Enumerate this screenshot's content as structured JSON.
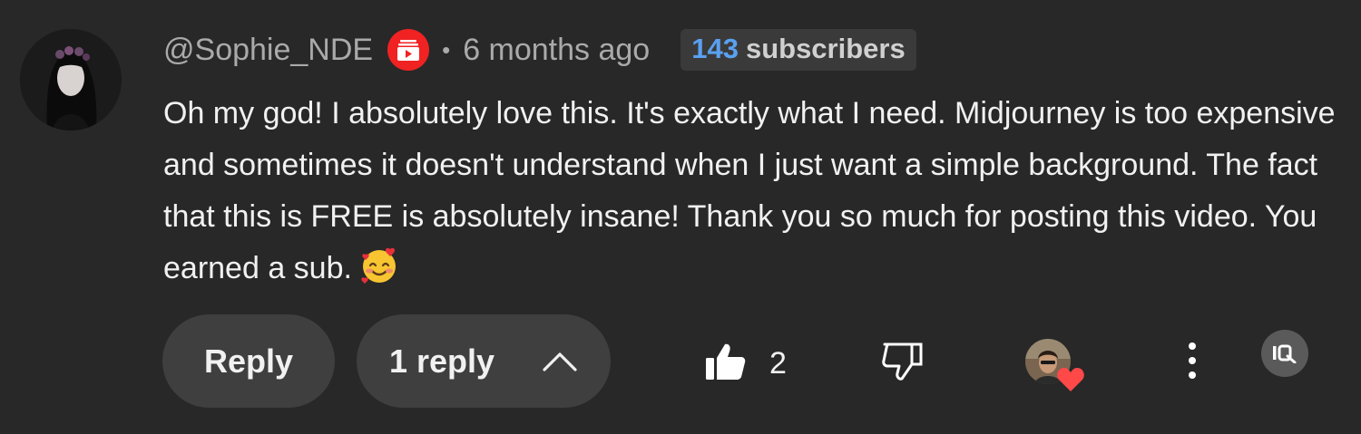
{
  "comment": {
    "author_handle": "@Sophie_NDE",
    "separator": "•",
    "timestamp": "6 months ago",
    "subscriber_count": "143",
    "subscriber_label": "subscribers",
    "text": "Oh my god! I absolutely love this. It's exactly what I need. Midjourney is too expensive and sometimes it doesn't understand when I just want a simple background. The fact that this is FREE is absolutely insane! Thank you so much for posting this video. You earned a sub.",
    "emoji": "smiling-face-with-hearts"
  },
  "actions": {
    "reply_label": "Reply",
    "replies_label": "1 reply",
    "like_count": "2"
  },
  "icons": {
    "creator_badge": "youtube-creator-icon",
    "like": "thumbs-up-icon",
    "dislike": "thumbs-down-icon",
    "heart": "heart-icon",
    "more": "more-vertical-icon",
    "extension": "extension-icon"
  },
  "colors": {
    "background": "#282828",
    "badge_red": "#f02222",
    "subscriber_blue": "#5aa0f0",
    "heart_red": "#ff4848",
    "button_bg": "#3f3f3f"
  }
}
